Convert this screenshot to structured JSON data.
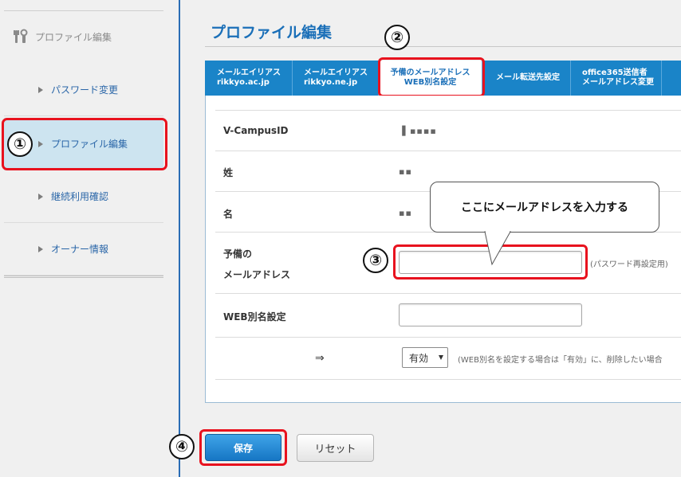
{
  "sidebar": {
    "header_label": "プロファイル編集",
    "items": [
      {
        "label": "パスワード変更"
      },
      {
        "label": "プロファイル編集"
      },
      {
        "label": "継続利用確認"
      },
      {
        "label": "オーナー情報"
      }
    ]
  },
  "page": {
    "title": "プロファイル編集"
  },
  "tabs": [
    {
      "line1": "メールエイリアス",
      "line2": "rikkyo.ac.jp"
    },
    {
      "line1": "メールエイリアス",
      "line2": "rikkyo.ne.jp"
    },
    {
      "line1": "予備のメールアドレス",
      "line2": "WEB別名設定"
    },
    {
      "line1": "メール転送先設定",
      "line2": ""
    },
    {
      "line1": "office365送信者",
      "line2": "メールアドレス変更"
    }
  ],
  "form": {
    "vcampus_label": "V-CampusID",
    "vcampus_value": "▐ ▪▪▪▪",
    "sei_label": "姓",
    "sei_value": "▪▪",
    "mei_label": "名",
    "mei_value": "▪▪",
    "spare_label_line1": "予備の",
    "spare_label_line2": "メールアドレス",
    "spare_value": "",
    "spare_hint": "(パスワード再設定用)",
    "web_label": "WEB別名設定",
    "web_value": "",
    "arrow": "⇒",
    "status_selected": "有効",
    "status_hint": "(WEB別名を設定する場合は「有効」に、削除したい場合"
  },
  "buttons": {
    "save": "保存",
    "reset": "リセット"
  },
  "annotations": {
    "step1": "①",
    "step2": "②",
    "step3": "③",
    "step4": "④",
    "callout": "ここにメールアドレスを入力する",
    "highlight_color": "#e8121e"
  }
}
